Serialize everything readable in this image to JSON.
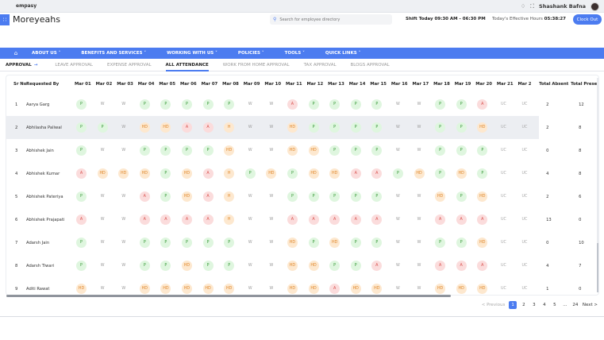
{
  "topbar": {
    "brand": "empasy",
    "user_name": "Shashank Bafna",
    "bell_icon": "bell-icon",
    "fullscreen_icon": "fullscreen-icon"
  },
  "header": {
    "title": "Moreyeahs",
    "search_placeholder": "Search for employee directory",
    "shift_text": "Shift Today 09:30 AM - 06:30 PM",
    "effective_label": "Today's Effective Hours",
    "effective_value": "05:38:27",
    "clock_out": "Clock Out"
  },
  "nav": {
    "items": [
      "ABOUT US ˅",
      "BENEFITS AND SERVICES ˅",
      "WORKING WITH US ˅",
      "POLICIES ˅",
      "TOOLS ˅",
      "QUICK LINKS ˅"
    ]
  },
  "subtabs": {
    "first": "APPROVAL",
    "items": [
      "LEAVE APPROVAL",
      "EXPENSE APPROVAL",
      "ALL ATTENDANCE",
      "WORK FROM HOME APPROVAL",
      "TAX APPROVAL",
      "BLOGS APPROVAL"
    ],
    "active_index": 2
  },
  "table": {
    "columns": [
      "Sr No.",
      "Requested By",
      "Mar 01",
      "Mar 02",
      "Mar 03",
      "Mar 04",
      "Mar 05",
      "Mar 06",
      "Mar 07",
      "Mar 08",
      "Mar 09",
      "Mar 10",
      "Mar 11",
      "Mar 12",
      "Mar 13",
      "Mar 14",
      "Mar 15",
      "Mar 16",
      "Mar 17",
      "Mar 18",
      "Mar 19",
      "Mar 20",
      "Mar 21",
      "Mar 2",
      "Total Absent",
      "Total Present"
    ],
    "rows": [
      {
        "sr": "1",
        "name": "Aarya Garg",
        "days": [
          "P",
          "W",
          "W",
          "P",
          "P",
          "P",
          "P",
          "P",
          "W",
          "W",
          "A",
          "P",
          "P",
          "P",
          "P",
          "W",
          "W",
          "P",
          "P",
          "A",
          "UC",
          "UC"
        ],
        "absent": "2",
        "present": "12"
      },
      {
        "sr": "2",
        "name": "Abhilasha Paliwal",
        "days": [
          "P",
          "P",
          "W",
          "HD",
          "HD",
          "A",
          "A",
          "H",
          "W",
          "W",
          "HD",
          "P",
          "P",
          "P",
          "P",
          "W",
          "W",
          "P",
          "P",
          "HD",
          "UC",
          "UC"
        ],
        "absent": "2",
        "present": "8"
      },
      {
        "sr": "3",
        "name": "Abhishek Jain",
        "days": [
          "P",
          "W",
          "W",
          "P",
          "P",
          "P",
          "P",
          "HD",
          "W",
          "W",
          "HD",
          "HD",
          "P",
          "P",
          "P",
          "W",
          "W",
          "P",
          "P",
          "P",
          "UC",
          "UC"
        ],
        "absent": "0",
        "present": "8"
      },
      {
        "sr": "4",
        "name": "Abhishek Kumar",
        "days": [
          "A",
          "HD",
          "HD",
          "HD",
          "P",
          "HD",
          "A",
          "H",
          "P",
          "HD",
          "P",
          "HD",
          "HD",
          "A",
          "A",
          "P",
          "HD",
          "P",
          "HD",
          "P",
          "UC",
          "UC"
        ],
        "absent": "4",
        "present": "8"
      },
      {
        "sr": "5",
        "name": "Abhishek Pateriya",
        "days": [
          "P",
          "W",
          "W",
          "A",
          "P",
          "HD",
          "A",
          "H",
          "W",
          "W",
          "P",
          "P",
          "P",
          "P",
          "P",
          "W",
          "W",
          "HD",
          "P",
          "HD",
          "UC",
          "UC"
        ],
        "absent": "2",
        "present": "6"
      },
      {
        "sr": "6",
        "name": "Abhishek Prajapati",
        "days": [
          "A",
          "W",
          "W",
          "A",
          "A",
          "A",
          "A",
          "H",
          "W",
          "W",
          "A",
          "A",
          "A",
          "A",
          "A",
          "W",
          "W",
          "A",
          "A",
          "A",
          "UC",
          "UC"
        ],
        "absent": "13",
        "present": "0"
      },
      {
        "sr": "7",
        "name": "Adarsh Jain",
        "days": [
          "P",
          "W",
          "W",
          "P",
          "P",
          "P",
          "P",
          "P",
          "W",
          "W",
          "HD",
          "P",
          "HD",
          "P",
          "P",
          "W",
          "W",
          "P",
          "P",
          "HD",
          "UC",
          "UC"
        ],
        "absent": "0",
        "present": "10"
      },
      {
        "sr": "8",
        "name": "Adarsh Tiwari",
        "days": [
          "P",
          "W",
          "W",
          "P",
          "P",
          "HD",
          "P",
          "P",
          "W",
          "W",
          "HD",
          "HD",
          "P",
          "P",
          "A",
          "W",
          "W",
          "A",
          "A",
          "A",
          "UC",
          "UC"
        ],
        "absent": "4",
        "present": "7"
      },
      {
        "sr": "9",
        "name": "Aditi Rawat",
        "days": [
          "HD",
          "W",
          "W",
          "HD",
          "HD",
          "HD",
          "HD",
          "HD",
          "W",
          "W",
          "HD",
          "HD",
          "A",
          "HD",
          "HD",
          "W",
          "W",
          "HD",
          "HD",
          "HD",
          "UC",
          "UC"
        ],
        "absent": "1",
        "present": "0"
      }
    ]
  },
  "pager": {
    "prev": "< Previous",
    "pages": [
      "1",
      "2",
      "3",
      "4",
      "5",
      "...",
      "24"
    ],
    "next": "Next >",
    "active": "1"
  },
  "colors": {
    "accent": "#4c7cf0",
    "present": "#3a9a3a",
    "absent": "#d9534f",
    "halfday": "#e0872b"
  }
}
